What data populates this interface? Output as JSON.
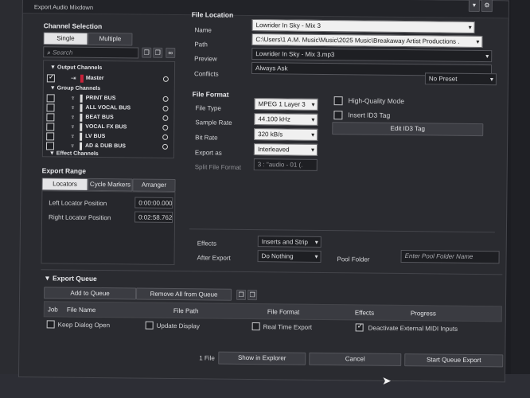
{
  "window": {
    "title": "Export Audio Mixdown"
  },
  "channel_selection": {
    "header": "Channel Selection",
    "modes": [
      "Single",
      "Multiple"
    ],
    "selected_mode": "Single",
    "search_placeholder": "Search",
    "tree": [
      {
        "label": "Output Channels",
        "level": 0,
        "type": "group"
      },
      {
        "label": "Master",
        "level": 1,
        "checked": true,
        "color": "#c8223a"
      },
      {
        "label": "Group Channels",
        "level": 0,
        "type": "group"
      },
      {
        "label": "PRINT BUS",
        "level": 1,
        "checked": false
      },
      {
        "label": "ALL VOCAL BUS",
        "level": 1,
        "checked": false
      },
      {
        "label": "BEAT BUS",
        "level": 1,
        "checked": false
      },
      {
        "label": "VOCAL FX BUS",
        "level": 1,
        "checked": false
      },
      {
        "label": "LV BUS",
        "level": 1,
        "checked": false
      },
      {
        "label": "AD & DUB BUS",
        "level": 1,
        "checked": false
      },
      {
        "label": "Effect Channels",
        "level": 0,
        "type": "group"
      }
    ]
  },
  "export_range": {
    "header": "Export Range",
    "tabs": [
      "Locators",
      "Cycle Markers",
      "Arranger"
    ],
    "selected_tab": "Locators",
    "left_label": "Left Locator Position",
    "left_value": "0:00:00.000",
    "right_label": "Right Locator Position",
    "right_value": "0:02:58.762"
  },
  "file_location": {
    "header": "File Location",
    "name_label": "Name",
    "name_value": "Lowrider In Sky - Mix 3",
    "path_label": "Path",
    "path_value": "C:\\Users\\1 A.M. Music\\Music\\2025 Music\\Breakaway Artist Productions .",
    "preview_label": "Preview",
    "preview_value": "Lowrider In Sky - Mix 3.mp3",
    "conflicts_label": "Conflicts",
    "conflicts_value": "Always Ask"
  },
  "preset": {
    "value": "No Preset"
  },
  "file_format": {
    "header": "File Format",
    "file_type_label": "File Type",
    "file_type_value": "MPEG 1 Layer 3",
    "sample_rate_label": "Sample Rate",
    "sample_rate_value": "44.100 kHz",
    "bit_rate_label": "Bit Rate",
    "bit_rate_value": "320 kB/s",
    "export_as_label": "Export as",
    "export_as_value": "Interleaved",
    "split_label": "Split File Format",
    "split_value": "3 : \"audio - 01 (.",
    "hq_label": "High-Quality Mode",
    "id3_label": "Insert ID3 Tag",
    "edit_id3_label": "Edit ID3 Tag"
  },
  "after": {
    "effects_label": "Effects",
    "effects_value": "Inserts and Strip",
    "after_export_label": "After Export",
    "after_export_value": "Do Nothing",
    "pool_folder_label": "Pool Folder",
    "pool_folder_placeholder": "Enter Pool Folder Name"
  },
  "queue": {
    "header": "Export Queue",
    "add_label": "Add to Queue",
    "remove_label": "Remove All from Queue",
    "columns": [
      "Job",
      "File Name",
      "File Path",
      "File Format",
      "Effects",
      "Progress"
    ]
  },
  "options": {
    "keep_open": "Keep Dialog Open",
    "update_display": "Update Display",
    "real_time": "Real Time Export",
    "deactivate_midi": "Deactivate External MIDI Inputs"
  },
  "footer": {
    "count": "1 File",
    "show_explorer": "Show in Explorer",
    "cancel": "Cancel",
    "start": "Start Queue Export"
  },
  "colors": {
    "dialog_bg": "#2a2b30",
    "accent_red": "#c8223a"
  }
}
